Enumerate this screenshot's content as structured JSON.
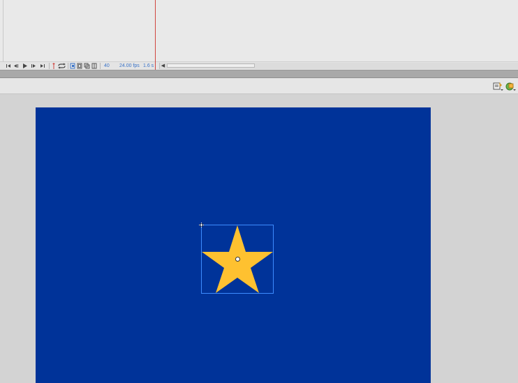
{
  "timeline": {
    "current_frame": "40",
    "frame_rate": "24.00 fps",
    "elapsed_time": "1.6 s",
    "scroll_left_arrow": "◀",
    "controls": [
      {
        "name": "first-frame-button"
      },
      {
        "name": "step-back-button"
      },
      {
        "name": "play-button"
      },
      {
        "name": "step-forward-button"
      },
      {
        "name": "last-frame-button"
      }
    ]
  },
  "stage": {
    "background_color": "#003399",
    "symbol": {
      "shape": "star-icon",
      "fill_color": "#FEC130",
      "selection_color": "#3D8CFF"
    }
  },
  "colors": {
    "playhead": "#D0453F",
    "accent": "#3A73C8"
  }
}
